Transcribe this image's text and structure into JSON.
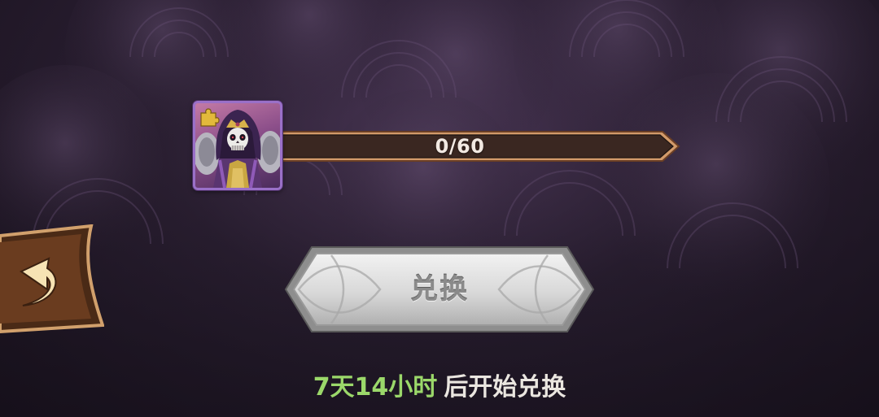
{
  "progress": {
    "text": "0/60",
    "current": 0,
    "total": 60
  },
  "exchange_button": {
    "label": "兑换",
    "state": "disabled"
  },
  "countdown": {
    "time": "7天14小时",
    "suffix": "后开始兑换"
  },
  "icons": {
    "hero": "skeleton-lich-hero-portrait",
    "puzzle": "puzzle-piece-icon",
    "back": "back-arrow-icon"
  },
  "colors": {
    "countdown_time": "#9bd86a",
    "countdown_text": "#eae6e0",
    "progress_bar": "#3a2721",
    "progress_border": "#c48e63",
    "frame_border": "#9a70c8"
  }
}
